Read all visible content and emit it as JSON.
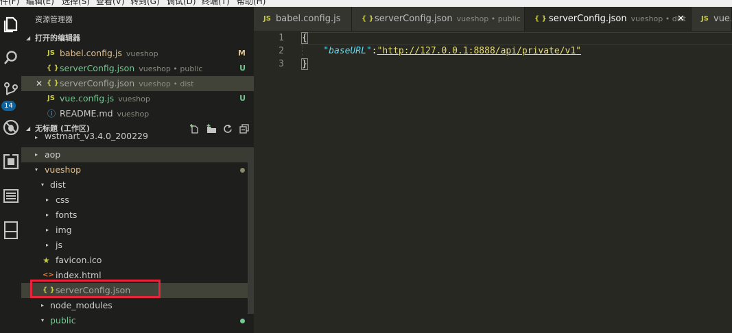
{
  "menubar": {
    "items": [
      "件(F)",
      "编辑(E)",
      "选择(S)",
      "查看(V)",
      "转到(G)",
      "调试(D)",
      "终端(T)",
      "帮助(H)"
    ]
  },
  "activity": {
    "badge": "14",
    "icons": [
      "files-icon",
      "search-icon",
      "source-control-icon",
      "no-debug-icon",
      "extensions-icon",
      "list-icon",
      "layout-icon"
    ]
  },
  "sidebar": {
    "title": "资源管理器",
    "open_editors": {
      "label": "打开的编辑器",
      "items": [
        {
          "icon": "JS",
          "name": "babel.config.js",
          "desc": "vueshop",
          "status": "M",
          "status_color": "#e2c08d"
        },
        {
          "icon": "{ }",
          "name": "serverConfig.json",
          "desc": "vueshop • public",
          "status": "U",
          "status_color": "#73c991"
        },
        {
          "icon": "{ }",
          "name": "serverConfig.json",
          "desc": "vueshop • dist",
          "status": "",
          "close": "✕"
        },
        {
          "icon": "JS",
          "name": "vue.config.js",
          "desc": "vueshop",
          "status": "U",
          "status_color": "#73c991"
        },
        {
          "icon": "ⓘ",
          "name": "README.md",
          "desc": "vueshop",
          "status": ""
        }
      ]
    },
    "workspace": {
      "label": "无标题 (工作区)",
      "tree": [
        {
          "name": "wstmart_v3.4.0_200229",
          "twisty": "▸"
        },
        {
          "name": "aop",
          "twisty": "▸"
        },
        {
          "name": "vueshop",
          "twisty": "▾"
        },
        {
          "name": "dist",
          "twisty": "▾"
        },
        {
          "name": "css",
          "twisty": "▸"
        },
        {
          "name": "fonts",
          "twisty": "▸"
        },
        {
          "name": "img",
          "twisty": "▸"
        },
        {
          "name": "js",
          "twisty": "▸"
        },
        {
          "name": "favicon.ico",
          "icon": "★"
        },
        {
          "name": "index.html",
          "icon": "<>"
        },
        {
          "name": "serverConfig.json",
          "icon": "{ }"
        },
        {
          "name": "node_modules",
          "twisty": "▸"
        },
        {
          "name": "public",
          "twisty": "▾"
        }
      ]
    }
  },
  "tabs": [
    {
      "icon": "JS",
      "name": "babel.config.js",
      "desc": ""
    },
    {
      "icon": "{ }",
      "name": "serverConfig.json",
      "desc": "vueshop • public"
    },
    {
      "icon": "{ }",
      "name": "serverConfig.json",
      "desc": "vueshop • dist",
      "close": "✕"
    },
    {
      "icon": "JS",
      "name": "vue.c",
      "desc": ""
    }
  ],
  "editor": {
    "line_numbers": [
      "1",
      "2",
      "3"
    ],
    "open_brace": "{",
    "close_brace": "}",
    "indent": "    ",
    "key": "\"baseURL\"",
    "colon": ":",
    "value": "\"http://127.0.0.1:8888/api/private/v1\""
  },
  "colors": {
    "accent_highlight": "#e8233c",
    "js_icon": "#cbcb41",
    "json_icon": "#cbcb41",
    "modified": "#e2c08d",
    "untracked": "#73c991"
  }
}
